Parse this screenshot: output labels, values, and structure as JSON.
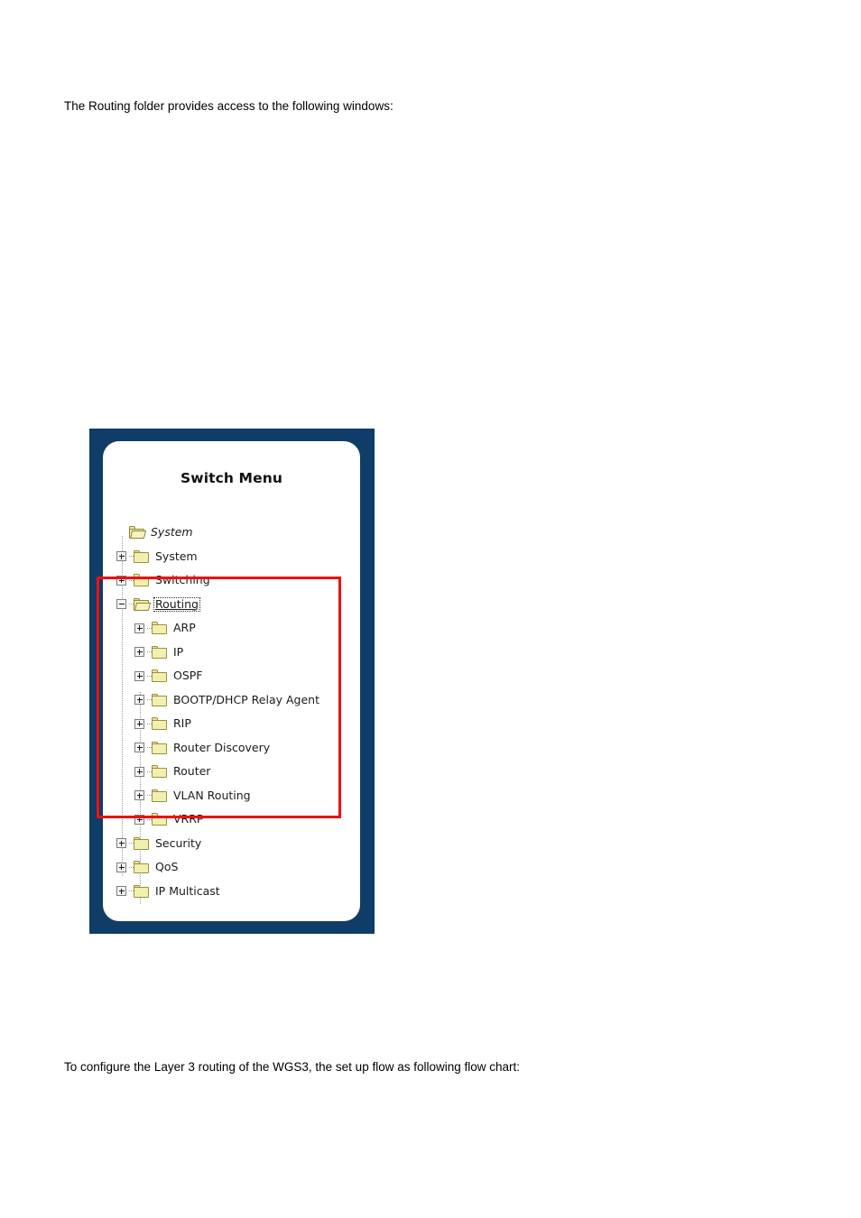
{
  "document": {
    "intro_text": "The Routing folder provides access to the following windows:",
    "outro_text": "To configure the Layer 3 routing of the WGS3, the set up flow as following flow chart:"
  },
  "figure": {
    "panel_title": "Switch Menu",
    "frame_color": "#103c68",
    "highlight_color": "#ee1111",
    "folder_color": "#f2f0ae",
    "folder_outline_color": "#9a9040",
    "tree": [
      {
        "label": "System",
        "level": 0,
        "icon": "open-folder-icon",
        "expander": "none",
        "italic": true,
        "selected": false,
        "highlighted": false
      },
      {
        "label": "System",
        "level": 1,
        "icon": "folder-icon",
        "expander": "plus",
        "italic": false,
        "selected": false,
        "highlighted": false
      },
      {
        "label": "Switching",
        "level": 1,
        "icon": "folder-icon",
        "expander": "plus",
        "italic": false,
        "selected": false,
        "highlighted": false
      },
      {
        "label": "Routing",
        "level": 1,
        "icon": "open-folder-icon",
        "expander": "minus",
        "italic": false,
        "selected": true,
        "highlighted": true
      },
      {
        "label": "ARP",
        "level": 2,
        "icon": "folder-icon",
        "expander": "plus",
        "italic": false,
        "selected": false,
        "highlighted": true
      },
      {
        "label": "IP",
        "level": 2,
        "icon": "folder-icon",
        "expander": "plus",
        "italic": false,
        "selected": false,
        "highlighted": true
      },
      {
        "label": "OSPF",
        "level": 2,
        "icon": "folder-icon",
        "expander": "plus",
        "italic": false,
        "selected": false,
        "highlighted": true
      },
      {
        "label": "BOOTP/DHCP Relay Agent",
        "level": 2,
        "icon": "folder-icon",
        "expander": "plus",
        "italic": false,
        "selected": false,
        "highlighted": true
      },
      {
        "label": "RIP",
        "level": 2,
        "icon": "folder-icon",
        "expander": "plus",
        "italic": false,
        "selected": false,
        "highlighted": true
      },
      {
        "label": "Router Discovery",
        "level": 2,
        "icon": "folder-icon",
        "expander": "plus",
        "italic": false,
        "selected": false,
        "highlighted": true
      },
      {
        "label": "Router",
        "level": 2,
        "icon": "folder-icon",
        "expander": "plus",
        "italic": false,
        "selected": false,
        "highlighted": true
      },
      {
        "label": "VLAN Routing",
        "level": 2,
        "icon": "folder-icon",
        "expander": "plus",
        "italic": false,
        "selected": false,
        "highlighted": true
      },
      {
        "label": "VRRP",
        "level": 2,
        "icon": "folder-icon",
        "expander": "plus",
        "italic": false,
        "selected": false,
        "highlighted": true
      },
      {
        "label": "Security",
        "level": 1,
        "icon": "folder-icon",
        "expander": "plus",
        "italic": false,
        "selected": false,
        "highlighted": false
      },
      {
        "label": "QoS",
        "level": 1,
        "icon": "folder-icon",
        "expander": "plus",
        "italic": false,
        "selected": false,
        "highlighted": false
      },
      {
        "label": "IP Multicast",
        "level": 1,
        "icon": "folder-icon",
        "expander": "plus",
        "italic": false,
        "selected": false,
        "highlighted": false
      }
    ]
  }
}
